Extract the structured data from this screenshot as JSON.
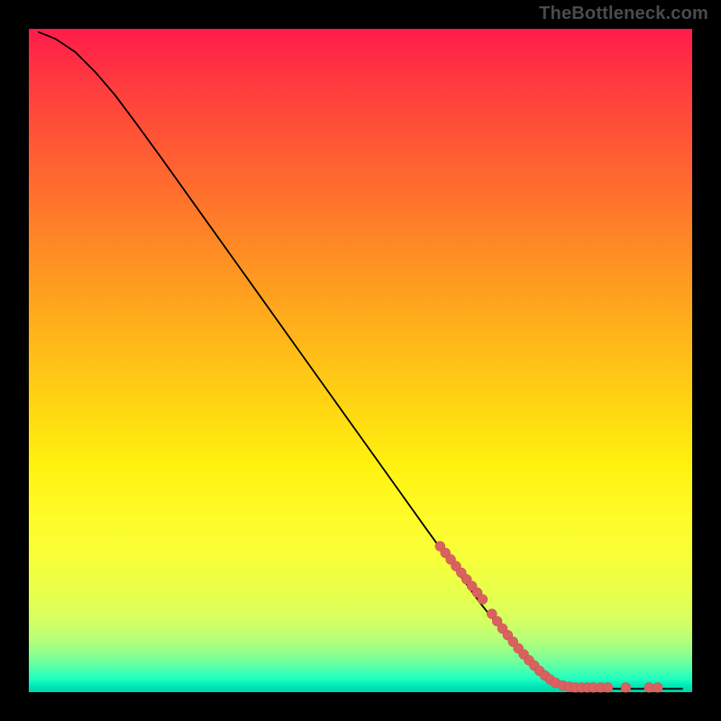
{
  "watermark": "TheBottleneck.com",
  "colors": {
    "background": "#000000",
    "curve": "#000000",
    "dot_fill": "#d9625f",
    "dot_stroke": "#c2504e",
    "watermark": "#4b4b4b"
  },
  "chart_data": {
    "type": "line",
    "title": "",
    "xlabel": "",
    "ylabel": "",
    "xlim": [
      0,
      100
    ],
    "ylim": [
      0,
      100
    ],
    "grid": false,
    "curve": [
      {
        "x": 1.5,
        "y": 99.5
      },
      {
        "x": 4.0,
        "y": 98.5
      },
      {
        "x": 7.0,
        "y": 96.5
      },
      {
        "x": 10.0,
        "y": 93.5
      },
      {
        "x": 13.0,
        "y": 90.0
      },
      {
        "x": 16.0,
        "y": 86.0
      },
      {
        "x": 20.0,
        "y": 80.5
      },
      {
        "x": 25.0,
        "y": 73.5
      },
      {
        "x": 30.0,
        "y": 66.5
      },
      {
        "x": 35.0,
        "y": 59.5
      },
      {
        "x": 40.0,
        "y": 52.5
      },
      {
        "x": 45.0,
        "y": 45.5
      },
      {
        "x": 50.0,
        "y": 38.5
      },
      {
        "x": 55.0,
        "y": 31.5
      },
      {
        "x": 60.0,
        "y": 24.5
      },
      {
        "x": 64.0,
        "y": 19.0
      },
      {
        "x": 68.0,
        "y": 13.5
      },
      {
        "x": 72.0,
        "y": 8.5
      },
      {
        "x": 76.0,
        "y": 4.0
      },
      {
        "x": 78.0,
        "y": 2.0
      },
      {
        "x": 80.0,
        "y": 1.0
      },
      {
        "x": 83.0,
        "y": 0.6
      },
      {
        "x": 88.0,
        "y": 0.5
      },
      {
        "x": 94.0,
        "y": 0.5
      },
      {
        "x": 98.5,
        "y": 0.5
      }
    ],
    "points": [
      {
        "x": 62.0,
        "y": 22.0,
        "r": 5.5
      },
      {
        "x": 62.8,
        "y": 21.0,
        "r": 5.5
      },
      {
        "x": 63.6,
        "y": 20.0,
        "r": 5.5
      },
      {
        "x": 64.4,
        "y": 19.0,
        "r": 5.5
      },
      {
        "x": 65.2,
        "y": 18.0,
        "r": 5.5
      },
      {
        "x": 66.0,
        "y": 17.0,
        "r": 5.5
      },
      {
        "x": 66.8,
        "y": 16.0,
        "r": 5.5
      },
      {
        "x": 67.6,
        "y": 15.0,
        "r": 5.5
      },
      {
        "x": 68.4,
        "y": 14.0,
        "r": 5.5
      },
      {
        "x": 69.8,
        "y": 11.8,
        "r": 5.5
      },
      {
        "x": 70.6,
        "y": 10.7,
        "r": 5.5
      },
      {
        "x": 71.4,
        "y": 9.6,
        "r": 5.5
      },
      {
        "x": 72.2,
        "y": 8.6,
        "r": 5.5
      },
      {
        "x": 73.0,
        "y": 7.6,
        "r": 5.5
      },
      {
        "x": 73.8,
        "y": 6.6,
        "r": 5.5
      },
      {
        "x": 74.6,
        "y": 5.7,
        "r": 5.5
      },
      {
        "x": 75.4,
        "y": 4.8,
        "r": 5.5
      },
      {
        "x": 76.2,
        "y": 4.0,
        "r": 5.5
      },
      {
        "x": 77.0,
        "y": 3.2,
        "r": 5.5
      },
      {
        "x": 77.8,
        "y": 2.5,
        "r": 5.5
      },
      {
        "x": 78.6,
        "y": 1.9,
        "r": 5.5
      },
      {
        "x": 79.4,
        "y": 1.4,
        "r": 5.5
      },
      {
        "x": 80.5,
        "y": 1.0,
        "r": 5.5
      },
      {
        "x": 81.5,
        "y": 0.8,
        "r": 5.5
      },
      {
        "x": 82.4,
        "y": 0.7,
        "r": 5.5
      },
      {
        "x": 83.3,
        "y": 0.7,
        "r": 5.5
      },
      {
        "x": 84.2,
        "y": 0.7,
        "r": 5.5
      },
      {
        "x": 85.1,
        "y": 0.7,
        "r": 5.5
      },
      {
        "x": 86.2,
        "y": 0.7,
        "r": 5.5
      },
      {
        "x": 87.3,
        "y": 0.7,
        "r": 5.5
      },
      {
        "x": 90.0,
        "y": 0.7,
        "r": 5.5
      },
      {
        "x": 93.5,
        "y": 0.7,
        "r": 5.5
      },
      {
        "x": 94.8,
        "y": 0.7,
        "r": 5.5
      }
    ]
  }
}
